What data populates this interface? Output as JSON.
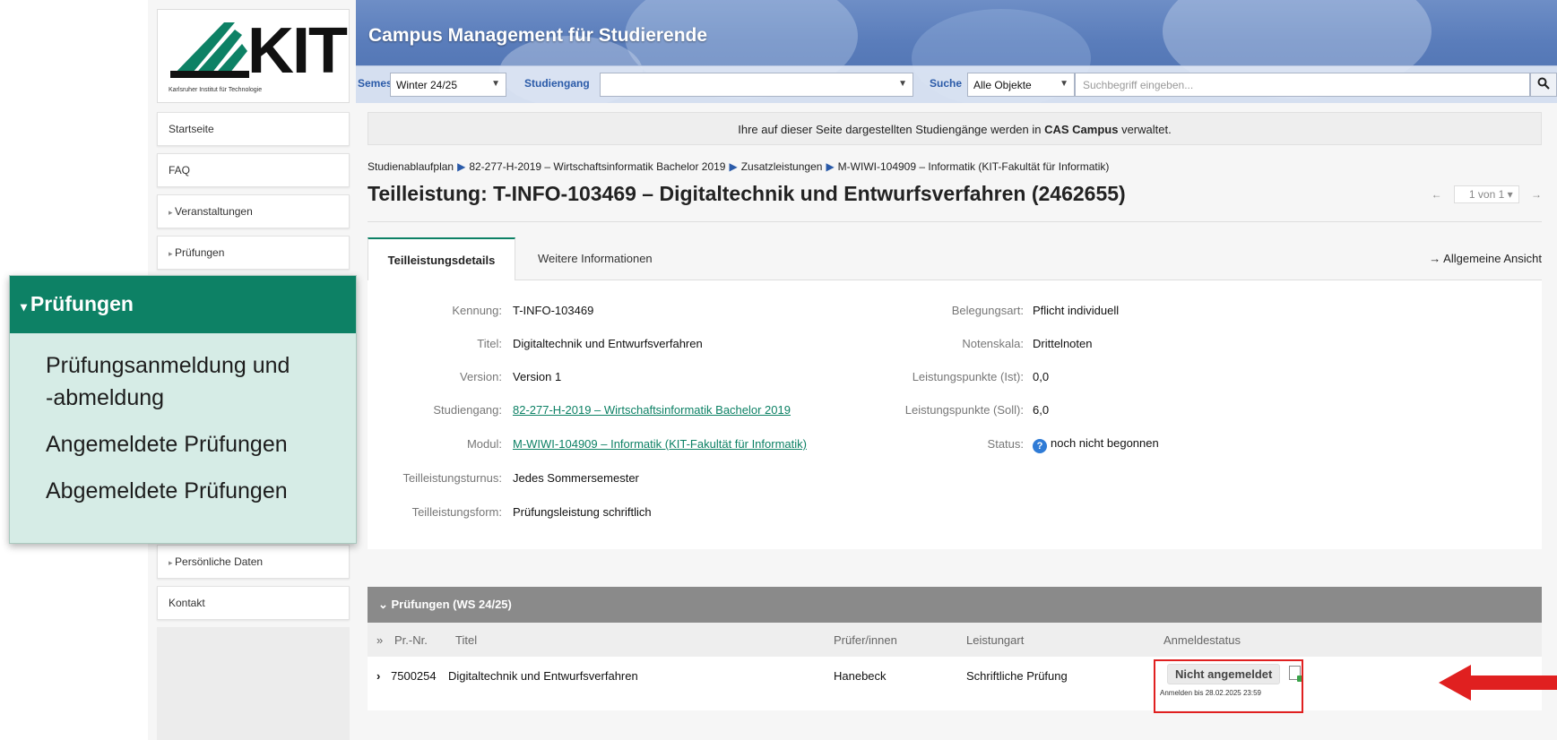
{
  "logo": {
    "wordmark": "KIT",
    "subtitle": "Karlsruher Institut für Technologie"
  },
  "header": {
    "title": "Campus Management für Studierende",
    "semester_label": "Semester",
    "semester_value": "Winter 24/25",
    "program_label": "Studiengang",
    "program_value": "",
    "search_label": "Suche",
    "search_scope": "Alle Objekte",
    "search_placeholder": "Suchbegriff eingeben..."
  },
  "sidebar": {
    "items": [
      {
        "label": "Startseite"
      },
      {
        "label": "FAQ"
      },
      {
        "label": "Veranstaltungen"
      },
      {
        "label": "Prüfungen"
      }
    ],
    "personal_data": "Persönliche Daten",
    "contact": "Kontakt"
  },
  "callout": {
    "heading": "Prüfungen",
    "links": [
      "Prüfungsanmeldung und",
      "-abmeldung",
      "Angemeldete Prüfungen",
      "Abgemeldete Prüfungen"
    ]
  },
  "notice": {
    "before": "Ihre auf dieser Seite dargestellten Studiengänge werden in ",
    "bold": "CAS Campus",
    "after": " verwaltet."
  },
  "breadcrumb": [
    "Studienablaufplan",
    "82-277-H-2019 – Wirtschaftsinformatik Bachelor 2019",
    "Zusatzleistungen",
    "M-WIWI-104909 – Informatik (KIT-Fakultät für Informatik)"
  ],
  "page": {
    "title": "Teilleistung: T-INFO-103469 – Digitaltechnik und Entwurfsverfahren (2462655)",
    "pager": "1 von 1"
  },
  "tabs": {
    "details": "Teilleistungsdetails",
    "more_info": "Weitere Informationen",
    "general_view": "→ Allgemeine Ansicht"
  },
  "details_left": [
    {
      "label": "Kennung:",
      "value": "T-INFO-103469"
    },
    {
      "label": "Titel:",
      "value": "Digitaltechnik und Entwurfsverfahren"
    },
    {
      "label": "Version:",
      "value": "Version 1"
    },
    {
      "label": "Studiengang:",
      "value": "82-277-H-2019 – Wirtschaftsinformatik Bachelor 2019"
    },
    {
      "label": "Modul:",
      "value": "M-WIWI-104909 – Informatik (KIT-Fakultät für Informatik)"
    },
    {
      "label": "Teilleistungsturnus:",
      "value": "Jedes Sommersemester"
    },
    {
      "label": "Teilleistungsform:",
      "value": "Prüfungsleistung schriftlich"
    }
  ],
  "details_right": [
    {
      "label": "Belegungsart:",
      "value": "Pflicht individuell"
    },
    {
      "label": "Notenskala:",
      "value": "Drittelnoten"
    },
    {
      "label": "Leistungspunkte (Ist):",
      "value": "0,0"
    },
    {
      "label": "Leistungspunkte (Soll):",
      "value": "6,0"
    },
    {
      "label": "Status:",
      "value": "noch nicht begonnen"
    }
  ],
  "exams": {
    "section_title": "Prüfungen (WS 24/25)",
    "columns": [
      "Pr.-Nr.",
      "Titel",
      "Prüfer/innen",
      "Leistungart",
      "Anmeldestatus"
    ],
    "row": {
      "number": "7500254",
      "title": "Digitaltechnik und Entwurfsverfahren",
      "examiner": "Hanebeck",
      "type": "Schriftliche Prüfung",
      "status": "Nicht angemeldet",
      "deadline": "Anmelden bis 28.02.2025 23:59"
    }
  },
  "colors": {
    "kit_green": "#0d8165",
    "banner_blue": "#5a7dbb",
    "highlight_red": "#e02020"
  }
}
